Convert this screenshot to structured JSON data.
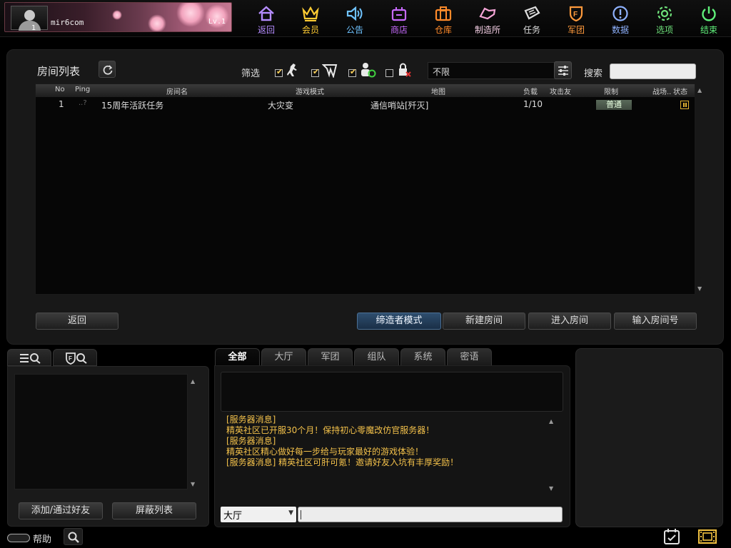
{
  "user": {
    "name": "mir6com",
    "avatar_level": "1",
    "level": "Lv.1"
  },
  "nav": [
    {
      "label": "返回",
      "icon": "home-icon",
      "color": "#b58cff"
    },
    {
      "label": "会员",
      "icon": "crown-icon",
      "color": "#ffcc33"
    },
    {
      "label": "公告",
      "icon": "speaker-icon",
      "color": "#6fc3ff"
    },
    {
      "label": "商店",
      "icon": "shop-icon",
      "color": "#c86bff"
    },
    {
      "label": "仓库",
      "icon": "storage-icon",
      "color": "#ff8a2a"
    },
    {
      "label": "制造所",
      "icon": "workshop-icon",
      "color": "#f6a6d8"
    },
    {
      "label": "任务",
      "icon": "task-icon",
      "color": "#dddddd"
    },
    {
      "label": "军团",
      "icon": "clan-icon",
      "color": "#ff9a3c"
    },
    {
      "label": "数据",
      "icon": "info-icon",
      "color": "#8fb2ff"
    },
    {
      "label": "选项",
      "icon": "gear-icon",
      "color": "#6ee07a"
    },
    {
      "label": "结束",
      "icon": "power-icon",
      "color": "#5ff07a"
    }
  ],
  "room_list": {
    "title": "房间列表",
    "filter_label": "筛选",
    "map_filter": "不限",
    "search_label": "搜索",
    "search_value": "",
    "columns": [
      "No",
      "Ping",
      "房间名",
      "游戏模式",
      "地图",
      "负载",
      "攻击友",
      "限制",
      "战场..",
      "状态"
    ],
    "rows": [
      {
        "no": "1",
        "ping": "..?",
        "name": "15周年活跃任务",
        "mode": "大灾变",
        "map": "通信哨站[歼灭]",
        "load": "1/10",
        "limit": "普通"
      }
    ]
  },
  "buttons": {
    "back": "返回",
    "creator_mode": "缔造者模式",
    "new_room": "新建房间",
    "enter_room": "进入房间",
    "enter_room_no": "输入房间号",
    "add_friend": "添加/通过好友",
    "block_list": "屏蔽列表"
  },
  "chat": {
    "tabs": [
      "全部",
      "大厅",
      "军团",
      "组队",
      "系统",
      "密语"
    ],
    "messages": [
      "[服务器消息]",
      "精英社区已开服30个月！保持初心零魔改仿官服务器！",
      "[服务器消息]",
      "精英社区精心做好每一步给与玩家最好的游戏体验！",
      "[服务器消息] 精英社区可肝可氪！邀请好友入坑有丰厚奖励！"
    ],
    "channel": "大厅",
    "input_value": ""
  },
  "bottom": {
    "help_label": "帮助"
  }
}
